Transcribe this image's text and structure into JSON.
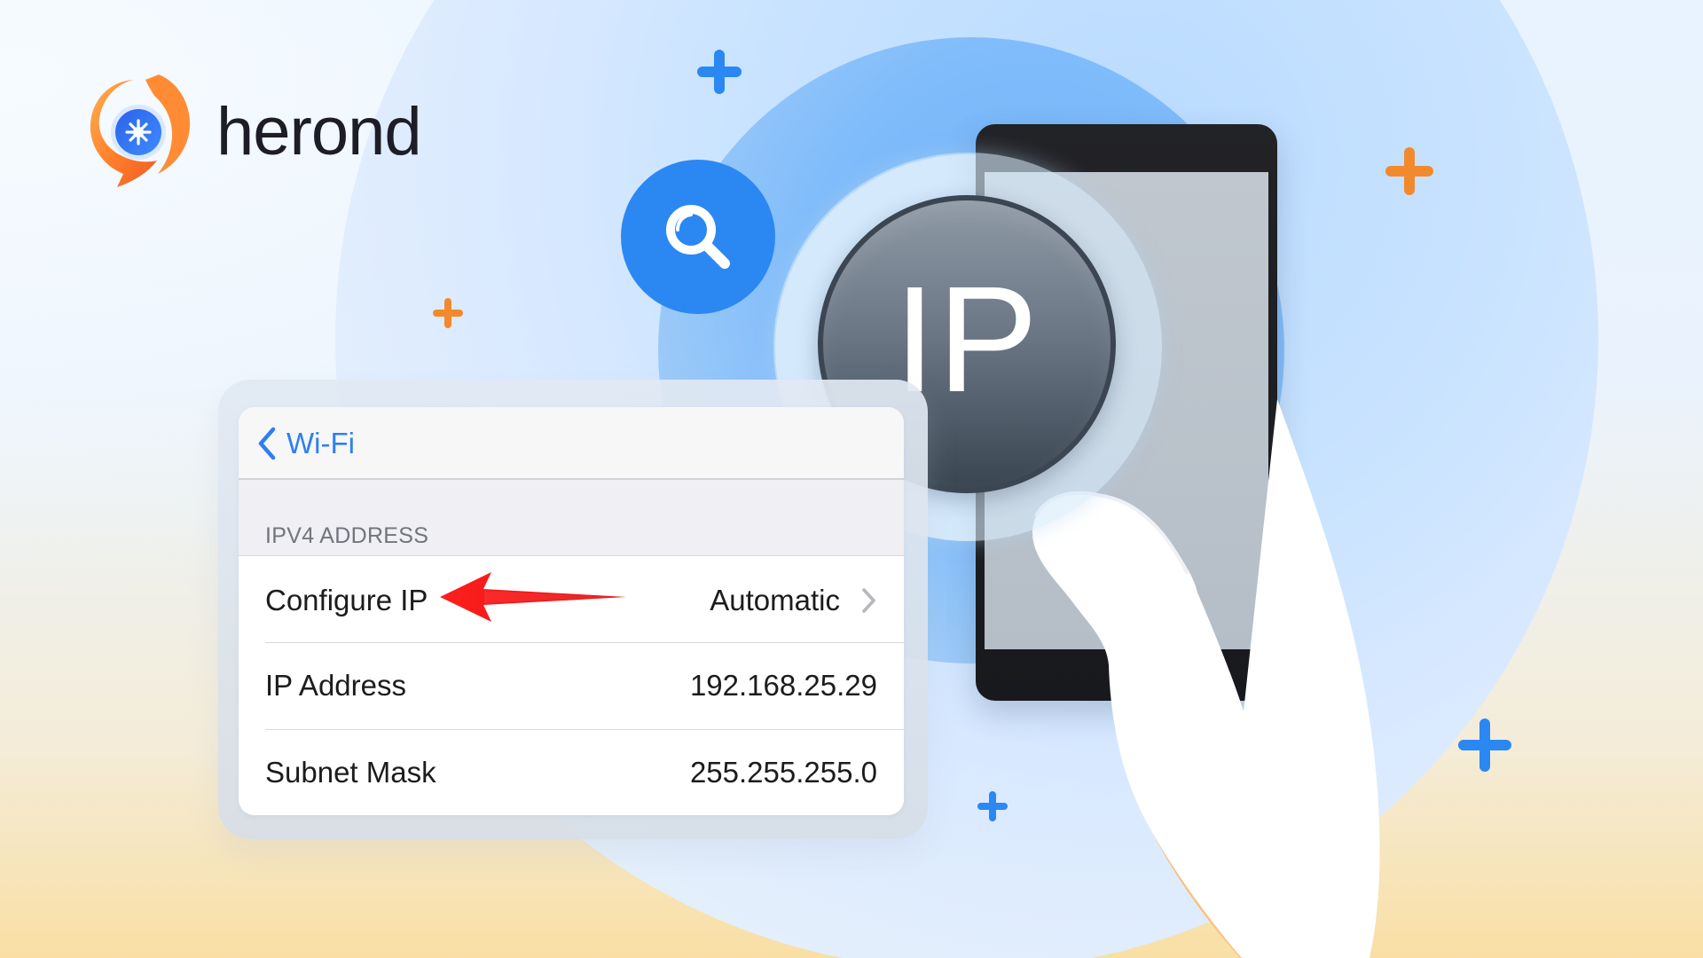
{
  "brand": {
    "name": "herond",
    "logo_icon": "herond-logo-icon"
  },
  "illustration": {
    "ip_badge_text": "IP",
    "search_icon": "search-icon",
    "phone_icon": "phone-icon",
    "hand_icon": "hand-icon",
    "plus_icon": "plus-icon"
  },
  "settings_panel": {
    "back_label": "Wi-Fi",
    "section_title": "IPV4 ADDRESS",
    "rows": [
      {
        "label": "Configure IP",
        "value": "Automatic"
      },
      {
        "label": "IP Address",
        "value": "192.168.25.29"
      },
      {
        "label": "Subnet Mask",
        "value": "255.255.255.0"
      }
    ]
  },
  "colors": {
    "accent_blue": "#2b88f2",
    "accent_orange": "#f28a2d",
    "arrow_red": "#ee1b1b"
  }
}
